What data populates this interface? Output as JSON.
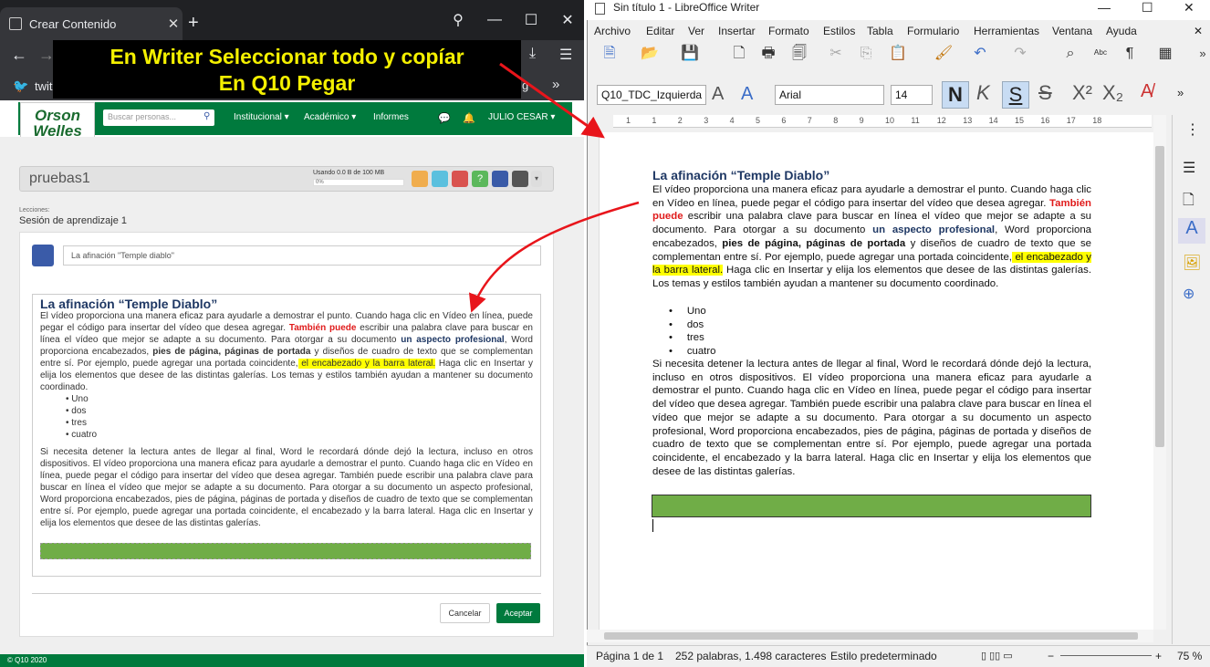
{
  "browser": {
    "tab_title": "Crear Contenido",
    "new_tab": "+",
    "bookmark": "twit",
    "overlay_line1": "En Writer Seleccionar todo y copíar",
    "overlay_line2": "En Q10 Pegar",
    "bookmark_trunc": "g"
  },
  "q10": {
    "logo_line1": "Orson",
    "logo_line2": "Welles",
    "search_placeholder": "Buscar personas...",
    "nav": [
      "Institucional",
      "Académico",
      "Informes"
    ],
    "user": "JULIO CESAR",
    "course": "pruebas1",
    "usage": "Usando 0.0 B de 100 MB",
    "usage_pct": "0%",
    "lecciones": "Lecciones:",
    "session": "Sesión de aprendizaje 1",
    "title_value": "La afinación \"Temple diablo\"",
    "heading": "La afinación “Temple Diablo”",
    "cancel": "Cancelar",
    "accept": "Aceptar",
    "footer": "© Q10 2020",
    "usage_fraction": 0
  },
  "doc": {
    "heading": "La afinación “Temple Diablo”",
    "p1a": "El vídeo proporciona una manera eficaz para ayudarle a demostrar el punto. Cuando haga clic en Vídeo en línea, puede pegar el código para insertar del vídeo que desea agregar. ",
    "p1b": "También puede",
    "p1c": " escribir una palabra clave para buscar en línea el vídeo que mejor se adapte a su documento. Para otorgar a su documento ",
    "p1d": "un aspecto profesional",
    "p1e": ", Word proporciona encabezados, ",
    "p1f": "pies de página, páginas de portada",
    "p1g": " y diseños de cuadro de texto que se complementan entre sí. Por ejemplo, puede agregar una portada coincidente,",
    "p1h": " el encabezado y la barra lateral.",
    "p1i": " Haga clic en Insertar y elija los elementos que desee de las distintas galerías. Los temas y estilos también ayudan a mantener su documento coordinado.",
    "list": [
      "Uno",
      "dos",
      "tres",
      "cuatro"
    ],
    "p2": "Si necesita detener la lectura antes de llegar al final, Word le recordará dónde dejó la lectura, incluso en otros dispositivos. El vídeo proporciona una manera eficaz para ayudarle a demostrar el punto. Cuando haga clic en Vídeo en línea, puede pegar el código para insertar del vídeo que desea agregar. También puede escribir una palabra clave para buscar en línea el vídeo que mejor se adapte a su documento. Para otorgar a su documento un aspecto profesional, Word proporciona encabezados, pies de página, páginas de portada y diseños de cuadro de texto que se complementan entre sí. Por ejemplo, puede agregar una portada coincidente, el encabezado y la barra lateral. Haga clic en Insertar y elija los elementos que desee de las distintas galerías."
  },
  "writer": {
    "title": "Sin título 1 - LibreOffice Writer",
    "menu": [
      "Archivo",
      "Editar",
      "Ver",
      "Insertar",
      "Formato",
      "Estilos",
      "Tabla",
      "Formulario",
      "Herramientas",
      "Ventana",
      "Ayuda"
    ],
    "style": "Q10_TDC_Izquierda",
    "font": "Arial",
    "size": "14",
    "ruler": [
      "1",
      "1",
      "2",
      "3",
      "4",
      "5",
      "6",
      "7",
      "8",
      "9",
      "10",
      "11",
      "12",
      "13",
      "14",
      "15",
      "16",
      "17",
      "18"
    ],
    "status_page": "Página 1 de 1",
    "status_words": "252 palabras, 1.498 caracteres",
    "status_style": "Estilo predeterminado",
    "zoom": "75 %"
  },
  "colors": {
    "accent": "#007a3d",
    "heading": "#1f3864",
    "highlight": "#ffff00",
    "red": "#e01b1b",
    "green_block": "#70ad47",
    "arrow": "#e8151b"
  }
}
